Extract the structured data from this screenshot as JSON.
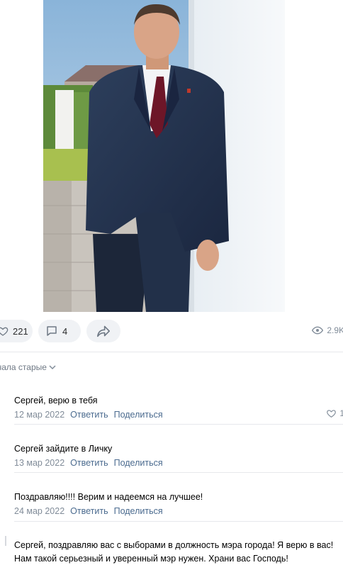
{
  "post": {
    "likes": "221",
    "comments": "4",
    "views": "2.9K"
  },
  "sort_label": "чала старые",
  "comments": [
    {
      "text": "Сергей, верю в тебя",
      "date": "12 мар 2022",
      "reply": "Ответить",
      "share": "Поделиться",
      "likes": "1"
    },
    {
      "text": "Сергей зайдите в Личку",
      "date": "13 мар 2022",
      "reply": "Ответить",
      "share": "Поделиться"
    },
    {
      "text": "Поздравляю!!!! Верим и надеемся на лучшее!",
      "date": "24 мар 2022",
      "reply": "Ответить",
      "share": "Поделиться"
    },
    {
      "text": "Сергей, поздравляю вас с выборами в должность мэра города! Я верю в вас! Нам такой серьезный и уверенный мэр нужен. Храни вас Господь!"
    }
  ],
  "icons": {
    "like": "heart-icon",
    "comment": "comment-bubble-icon",
    "share": "share-arrow-icon",
    "views": "eye-icon",
    "sort": "chevron-down-icon"
  },
  "colors": {
    "link": "#4b6b8f",
    "muted": "#818c99",
    "pill_bg": "#f0f2f5"
  }
}
